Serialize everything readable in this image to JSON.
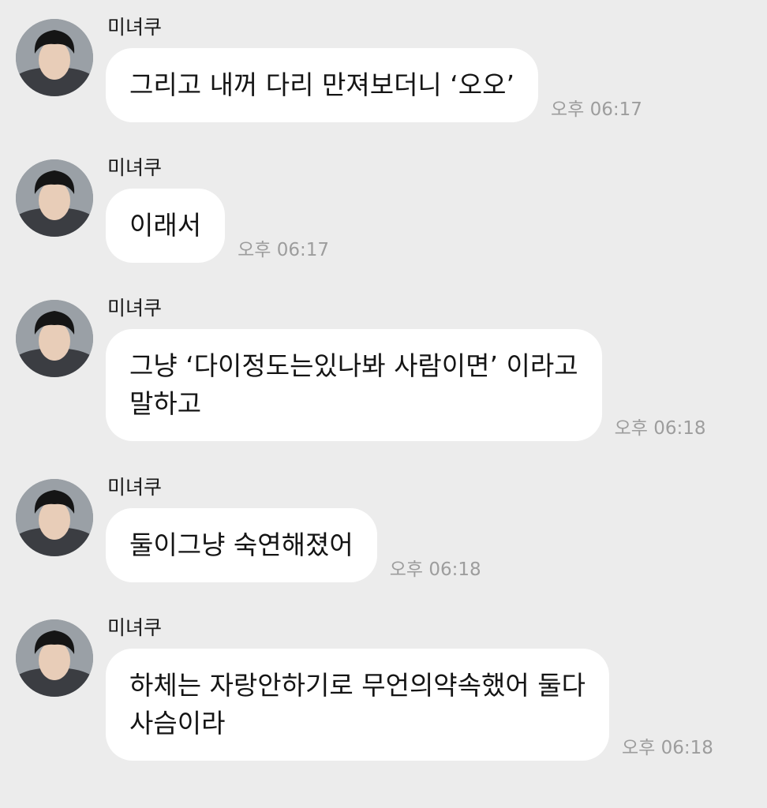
{
  "messages": [
    {
      "sender": "미녀쿠",
      "text": "그리고 내꺼 다리 만져보더니 ‘오오’",
      "time": "오후 06:17"
    },
    {
      "sender": "미녀쿠",
      "text": "이래서",
      "time": "오후 06:17"
    },
    {
      "sender": "미녀쿠",
      "text": "그냥 ‘다이정도는있나봐 사람이면’ 이라고\n말하고",
      "time": "오후 06:18"
    },
    {
      "sender": "미녀쿠",
      "text": "둘이그냥 숙연해졌어",
      "time": "오후 06:18"
    },
    {
      "sender": "미녀쿠",
      "text": "하체는 자랑안하기로 무언의약속했어 둘다\n사슴이라",
      "time": "오후 06:18"
    }
  ],
  "icons": {
    "avatar": "profile-photo-icon"
  },
  "colors": {
    "background": "#ececec",
    "bubble": "#ffffff",
    "timestamp": "#9d9d9d",
    "text": "#141414"
  }
}
